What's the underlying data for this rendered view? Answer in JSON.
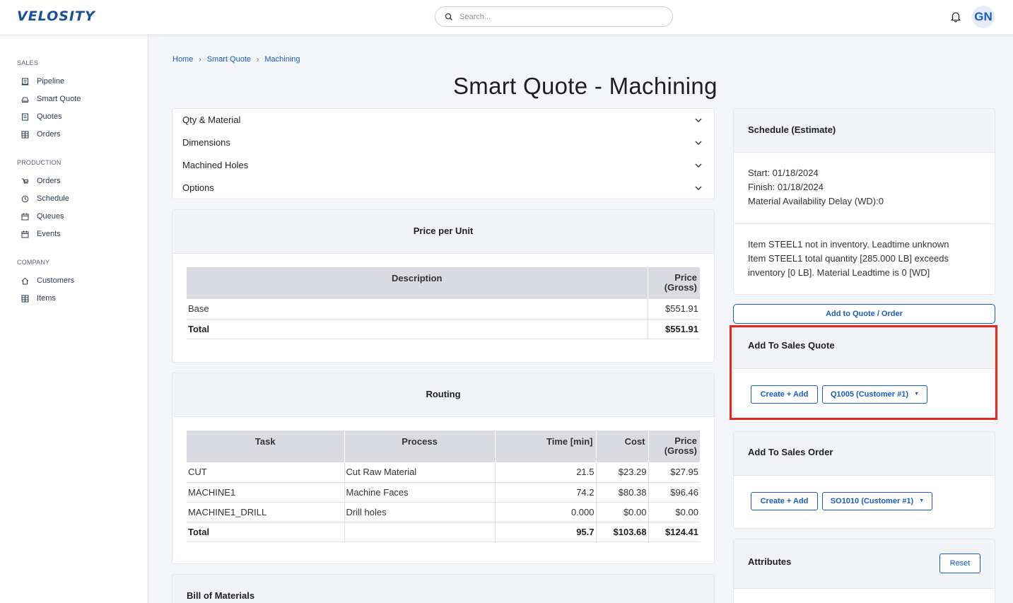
{
  "app": {
    "logo_text": "VELOSITY",
    "brand_color": "#1a4f9c",
    "link_color": "#1a5bc4"
  },
  "search": {
    "placeholder": "Search..."
  },
  "user": {
    "initials": "GN"
  },
  "sidebar": {
    "sections": [
      {
        "title": "SALES",
        "items": [
          {
            "label": "Pipeline",
            "icon": "pipeline-icon"
          },
          {
            "label": "Smart Quote",
            "icon": "smart-quote-icon"
          },
          {
            "label": "Quotes",
            "icon": "quotes-icon"
          },
          {
            "label": "Orders",
            "icon": "orders-icon"
          }
        ]
      },
      {
        "title": "PRODUCTION",
        "items": [
          {
            "label": "Orders",
            "icon": "production-orders-icon"
          },
          {
            "label": "Schedule",
            "icon": "clock-icon"
          },
          {
            "label": "Queues",
            "icon": "calendar-icon"
          },
          {
            "label": "Events",
            "icon": "calendar-icon"
          }
        ]
      },
      {
        "title": "COMPANY",
        "items": [
          {
            "label": "Customers",
            "icon": "home-icon"
          },
          {
            "label": "Items",
            "icon": "grid-icon"
          }
        ]
      }
    ]
  },
  "breadcrumb": [
    "Home",
    "Smart Quote",
    "Machining"
  ],
  "page": {
    "title": "Smart Quote - Machining"
  },
  "accordion": [
    "Qty & Material",
    "Dimensions",
    "Machined Holes",
    "Options"
  ],
  "price_per_unit": {
    "title": "Price per Unit",
    "headers": [
      "Description",
      "Price",
      "(Gross)"
    ],
    "rows": [
      [
        "Base",
        "$551.91"
      ]
    ],
    "total": [
      "Total",
      "$551.91"
    ]
  },
  "routing": {
    "title": "Routing",
    "headers": [
      "Task",
      "Process",
      "Time [min]",
      "Cost",
      "Price",
      "(Gross)"
    ],
    "rows": [
      [
        "CUT",
        "Cut Raw Material",
        "21.5",
        "$23.29",
        "$27.95"
      ],
      [
        "MACHINE1",
        "Machine Faces",
        "74.2",
        "$80.38",
        "$96.46"
      ],
      [
        "MACHINE1_DRILL",
        "Drill holes",
        "0.000",
        "$0.00",
        "$0.00"
      ]
    ],
    "total": [
      "Total",
      "",
      "95.7",
      "$103.68",
      "$124.41"
    ]
  },
  "bom": {
    "title": "Bill of Materials"
  },
  "schedule": {
    "title": "Schedule (Estimate)",
    "lines": [
      "Start: 01/18/2024",
      "Finish: 01/18/2024",
      "Material Availability Delay (WD):0"
    ],
    "notes": [
      "Item STEEL1 not in inventory. Leadtime unknown",
      "Item STEEL1 total quantity [285.000 LB] exceeds",
      "inventory [0 LB]. Material Leadtime is 0 [WD]"
    ]
  },
  "add_to_quote_order_label": "Add to Quote / Order",
  "sales_quote": {
    "title": "Add To Sales Quote",
    "create_label": "Create + Add",
    "select_label": "Q1005 (Customer #1)"
  },
  "sales_order": {
    "title": "Add To Sales Order",
    "create_label": "Create + Add",
    "select_label": "SO1010 (Customer #1)"
  },
  "attributes": {
    "title": "Attributes",
    "reset_label": "Reset"
  }
}
